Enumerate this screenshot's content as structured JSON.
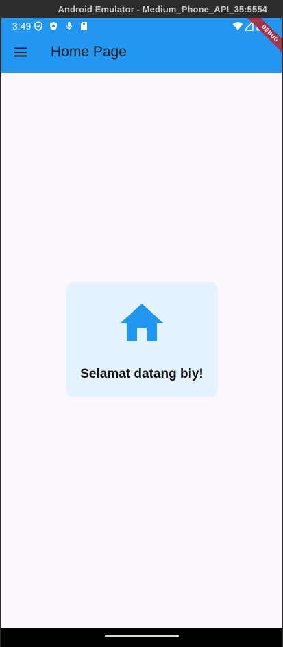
{
  "window": {
    "title": "Android Emulator - Medium_Phone_API_35:5554"
  },
  "status_bar": {
    "time": "3:49",
    "icons_left": [
      "shield-outline-icon",
      "shield-filled-icon",
      "mic-icon",
      "sd-card-icon"
    ],
    "icons_right": [
      "wifi-icon",
      "signal-icon",
      "battery-icon"
    ]
  },
  "app_bar": {
    "title": "Home Page",
    "menu_icon": "menu-icon",
    "debug_banner": "DEBUG",
    "color": "#2196f3"
  },
  "content": {
    "icon": "home-icon",
    "greeting": "Selamat datang biy!",
    "card_color": "#e3f2fd",
    "icon_color": "#2196f3"
  },
  "navigation_bar": {
    "handle": "home-pill"
  }
}
